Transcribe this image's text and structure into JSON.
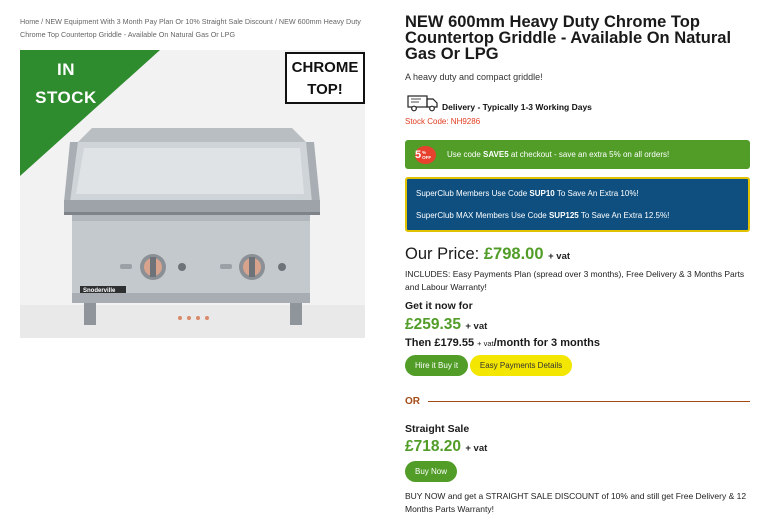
{
  "breadcrumb": {
    "home": "Home",
    "sep": " / ",
    "category": "NEW Equipment With 3 Month Pay Plan Or 10% Straight Sale Discount",
    "current": "NEW 600mm Heavy Duty Chrome Top Countertop Griddle - Available On Natural Gas Or LPG"
  },
  "image": {
    "stock_badge": "IN STOCK",
    "chrome_badge": "CHROME TOP!",
    "brand_plate": "Snoderville",
    "colors": {
      "stock_triangle": "#2e8b2e",
      "steel": "#c7ccd0"
    }
  },
  "product": {
    "title": "NEW 600mm Heavy Duty Chrome Top Countertop Griddle - Available On Natural Gas Or LPG",
    "subtitle": "A heavy duty and compact griddle!",
    "delivery": "Delivery - Typically 1-3 Working Days",
    "stock_code": "Stock Code: NH9286"
  },
  "promo": {
    "badge_number": "5",
    "badge_small": "% OFF",
    "text_before": "Use code ",
    "code": "SAVE5",
    "text_after": " at checkout - save an extra 5% on all orders!",
    "color": "#519d28"
  },
  "superclub": {
    "line1_before": "SuperClub Members Use Code ",
    "line1_code": "SUP10",
    "line1_after": " To Save An Extra 10%!",
    "line2_before": "SuperClub MAX Members Use Code ",
    "line2_code": "SUP125",
    "line2_after": " To Save An Extra 12.5%!",
    "color": "#0e4f80"
  },
  "pricing": {
    "our_price_label": "Our Price: ",
    "our_price": "£798.00",
    "vat": "+ vat",
    "includes": "INCLUDES: Easy Payments Plan (spread over 3 months), Free Delivery & 3 Months Parts and Labour Warranty!",
    "get_now_label": "Get it now for",
    "get_now_price": "£259.35",
    "then_text": "Then £179.55 ",
    "then_vat": "+ vat",
    "then_tail": "/month for 3 months",
    "hire_button": "Hire it Buy it",
    "easy_button": "Easy Payments Details",
    "or_label": "OR",
    "straight_label": "Straight Sale",
    "straight_price": "£718.20",
    "buy_now_button": "Buy Now",
    "buy_now_text": "BUY NOW and get a STRAIGHT SALE DISCOUNT of 10% and still get Free Delivery & 12 Months Parts Warranty!"
  }
}
